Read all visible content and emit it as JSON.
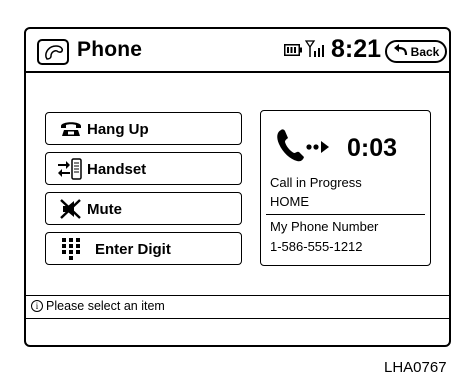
{
  "header": {
    "title": "Phone",
    "clock": "8:21",
    "back_label": "Back",
    "icons": [
      "phone-app-icon",
      "battery-icon",
      "signal-icon",
      "back-arrow-icon"
    ]
  },
  "menu": [
    {
      "label": "Hang Up",
      "icon": "hang-up-icon"
    },
    {
      "label": "Handset",
      "icon": "handset-icon"
    },
    {
      "label": "Mute",
      "icon": "mute-icon"
    },
    {
      "label": "Enter Digit",
      "icon": "keypad-icon"
    }
  ],
  "call": {
    "timer": "0:03",
    "status": "Call in Progress",
    "caller": "HOME",
    "my_number_label": "My Phone Number",
    "my_number": "1-586-555-1212",
    "icon": "active-call-icon"
  },
  "status_bar": {
    "message": "Please select an item",
    "icon": "info-icon"
  },
  "caption": "LHA0767"
}
